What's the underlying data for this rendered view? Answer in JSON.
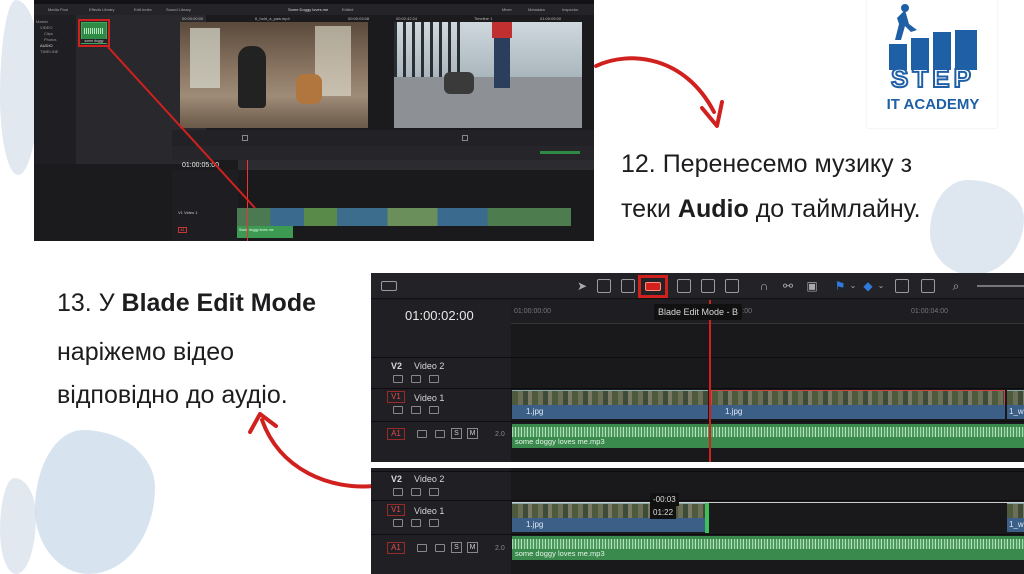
{
  "slide": {
    "step12": {
      "prefix": "12. Перенесемо музику з",
      "line2_pre": "теки ",
      "line2_bold": "Audio",
      "line2_post": " до таймлайну."
    },
    "step13": {
      "prefix": "13. У ",
      "bold": "Blade Edit Mode",
      "line2": "наріжемо відео",
      "line3": "відповідно до аудіо."
    },
    "logo": {
      "word1": "STEP",
      "word2": "IT ACADEMY"
    },
    "accent_color": "#d0211f"
  },
  "screenshot_top": {
    "tabs": [
      "Media Pool",
      "Effects Library",
      "Edit Index",
      "Sound Library"
    ],
    "project_title": "Some Doggy loves me",
    "edited_label": "Edited",
    "viewer_left_title": "6_hold_a_paw.mp4",
    "viewer_right_title": "Timeline 1",
    "timecode_left": "00:00:00:00",
    "timecode_mid": "00:00:03:08",
    "timecode_right": "00:02:42:24",
    "timecode_far": "01:00:05:00",
    "right_tabs": [
      "Mixer",
      "Metadata",
      "Inspector"
    ],
    "tree": [
      "Master",
      "VIDEO",
      "Clips",
      "Photos",
      "AUDIO",
      "TIMELINE"
    ],
    "audio_thumb_label": "some doggy",
    "timeline_timecode": "01:00:05:00",
    "track_v1": "V1",
    "track_v1_name": "Video 1",
    "track_a1": "A1",
    "audio_clip_label": "Some doggy loves me"
  },
  "screenshot_bottom": {
    "tooltip": "Blade Edit Mode - B",
    "timecode": "01:00:02:00",
    "ruler_ticks": [
      "01:00:00:00",
      "01:00:02:00",
      "01:00:04:00"
    ],
    "tracks": {
      "v2": {
        "id": "V2",
        "name": "Video 2"
      },
      "v1": {
        "id": "V1",
        "name": "Video 1"
      },
      "a1": {
        "id": "A1",
        "channels": "2.0"
      }
    },
    "clip_video_name": "1.jpg",
    "clip_video_name_alt": "1_wa",
    "audio_name": "some doggy loves me.mp3",
    "lower": {
      "duration_delta": "-00:03",
      "duration_value": "01:22",
      "clip_video_name": "1.jpg",
      "clip_video_name_alt": "1_wa",
      "audio_name": "some doggy loves me.mp3"
    },
    "solo_label": "S",
    "mute_label": "M"
  }
}
